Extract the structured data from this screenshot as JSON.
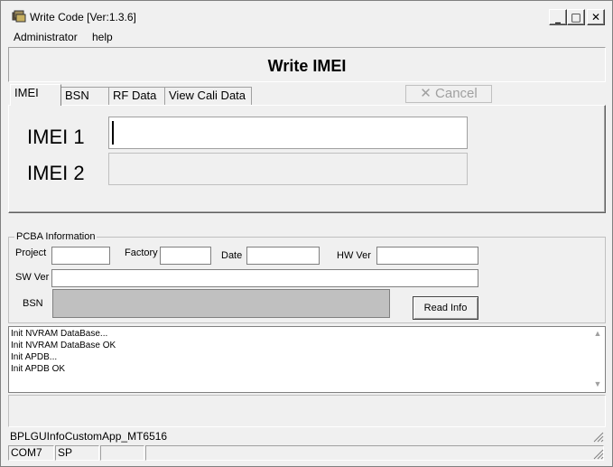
{
  "window": {
    "title": "Write Code [Ver:1.3.6]",
    "minimize": "_",
    "maximize": "□",
    "close": "✕"
  },
  "menu": {
    "items": [
      "Administrator",
      "help"
    ]
  },
  "header": {
    "title": "Write IMEI"
  },
  "tabs": [
    {
      "label": "IMEI",
      "active": true
    },
    {
      "label": "BSN",
      "active": false
    },
    {
      "label": "RF Data",
      "active": false
    },
    {
      "label": "View Cali Data",
      "active": false
    }
  ],
  "cancel": {
    "label": "Cancel",
    "icon": "x-icon",
    "enabled": false
  },
  "imei": {
    "label1": "IMEI 1",
    "value1": "",
    "label2": "IMEI 2",
    "value2": ""
  },
  "pcba": {
    "legend": "PCBA Information",
    "project_label": "Project",
    "project_value": "",
    "factory_label": "Factory",
    "factory_value": "",
    "date_label": "Date",
    "date_value": "",
    "hwver_label": "HW Ver",
    "hwver_value": "",
    "swver_label": "SW Ver",
    "swver_value": "",
    "bsn_label": "BSN",
    "bsn_value": "",
    "read_button": "Read Info"
  },
  "log": {
    "lines": [
      "Init NVRAM DataBase...",
      "Init NVRAM DataBase OK",
      "Init APDB...",
      "Init APDB OK"
    ]
  },
  "status": {
    "app_name": "BPLGUInfoCustomApp_MT6516",
    "port": "COM7",
    "mode": "SP",
    "cell3": "",
    "cell4": ""
  },
  "colors": {
    "window_bg": "#f0f0f0",
    "input_bg": "#ffffff",
    "disabled_bg": "#c0c0c0"
  }
}
